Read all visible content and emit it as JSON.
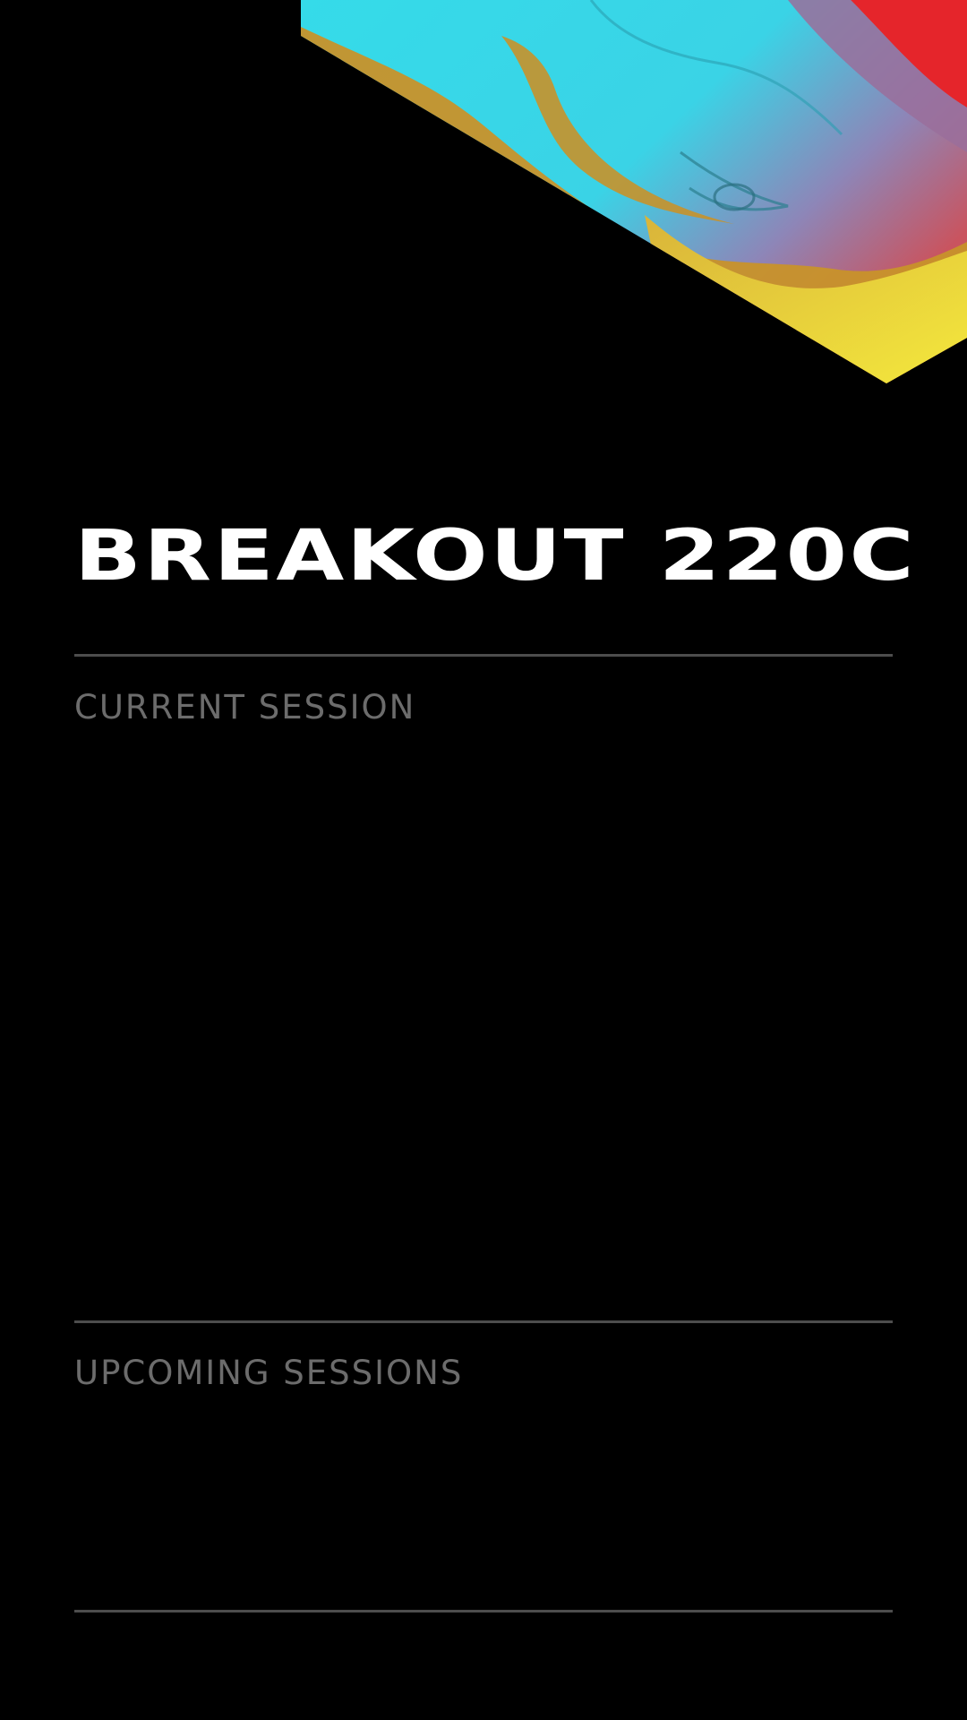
{
  "room": {
    "title": "BREAKOUT 220C"
  },
  "sections": {
    "current_label": "CURRENT SESSION",
    "upcoming_label": "UPCOMING SESSIONS"
  },
  "theme": {
    "background": "#000000",
    "title_color": "#ffffff",
    "label_color": "#6c6c6c",
    "divider_color": "#4d4d4d",
    "art_colors": [
      "#35dbe9",
      "#c8922a",
      "#f3e23a",
      "#e5252b",
      "#9a6e9b"
    ]
  }
}
